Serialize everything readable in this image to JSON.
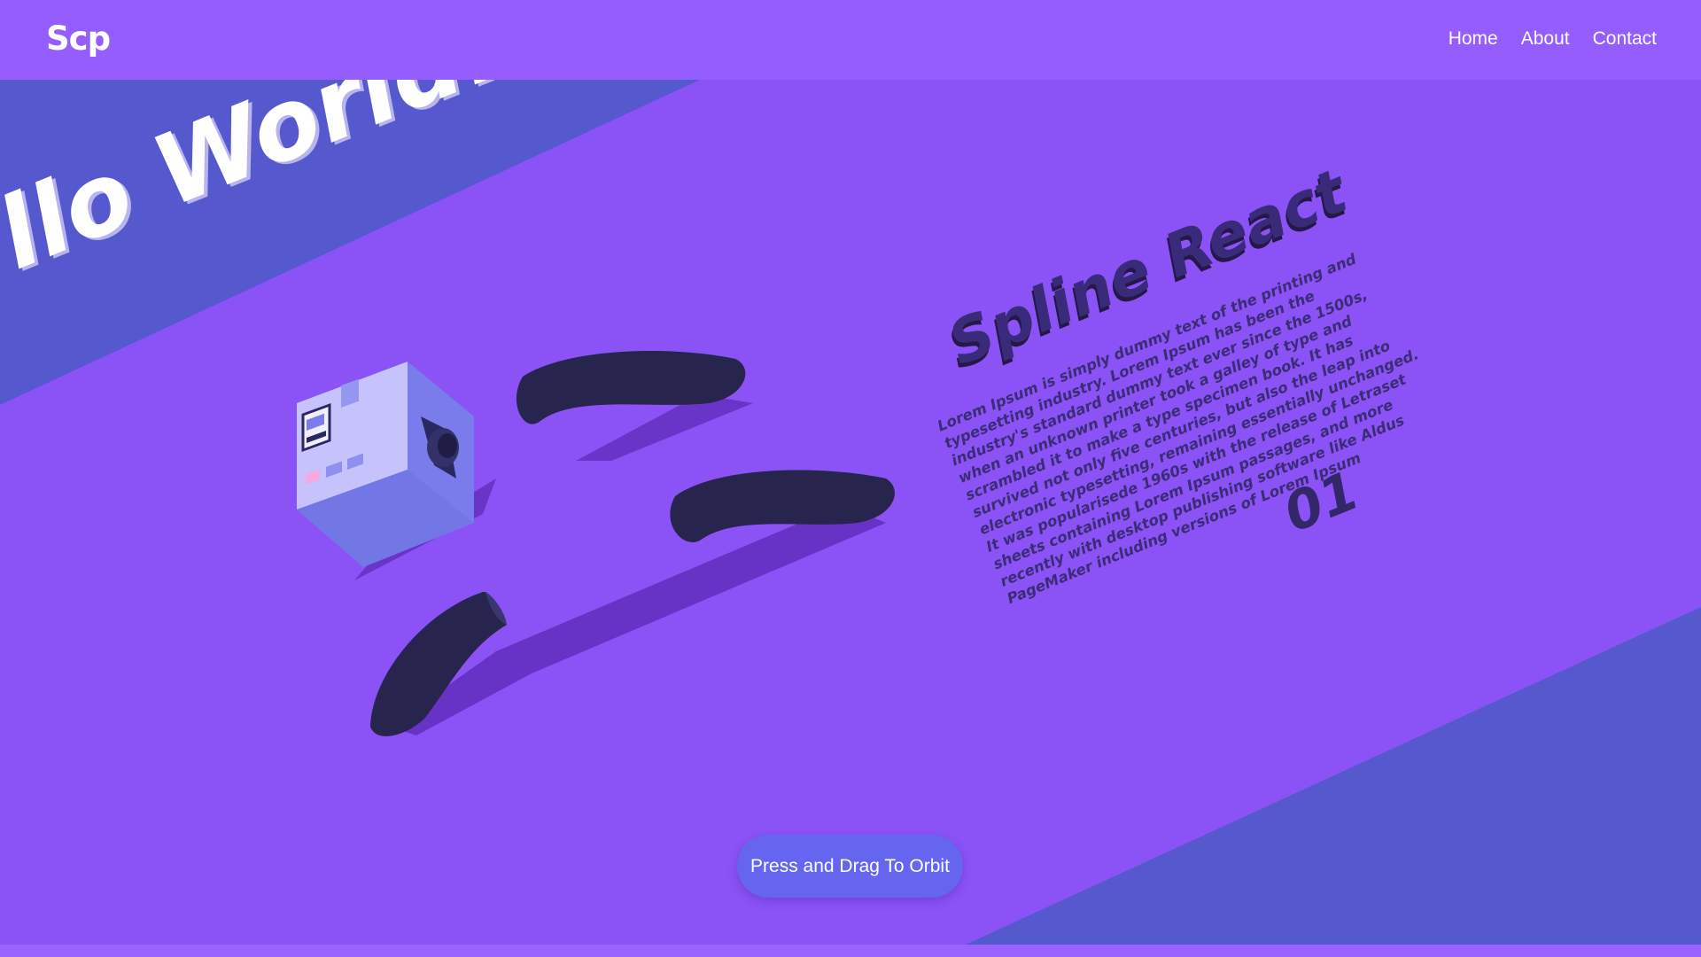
{
  "navbar": {
    "logo": "Scp",
    "links": [
      "Home",
      "About",
      "Contact"
    ]
  },
  "scene": {
    "hello_text": "llo World!",
    "spline_title": "Spline React",
    "spline_body": "Lorem Ipsum is simply dummy text of the printing and typesetting industry. Lorem Ipsum has been the industry's standard dummy text ever since the 1500s, when an unknown printer took a galley of type and scrambled it to make a type specimen book. It has survived not only five centuries, but also the leap into electronic typesetting, remaining essentially unchanged. It was popularisede 1960s with the release of Letraset sheets containing Lorem Ipsum passages, and more recently with desktop publishing software like Aldus PageMaker including versions of Lorem Ipsum",
    "spline_number": "01"
  },
  "orbit_button": "Press and Drag To Orbit",
  "colors": {
    "background": "#8b52f6",
    "navbar": "#955cfe",
    "band": "#5659cd",
    "button": "#6565ef",
    "shape_dark": "#27244d",
    "cube_light": "#c6c2fb"
  },
  "icons": [
    "cube-object",
    "torus-shape"
  ]
}
